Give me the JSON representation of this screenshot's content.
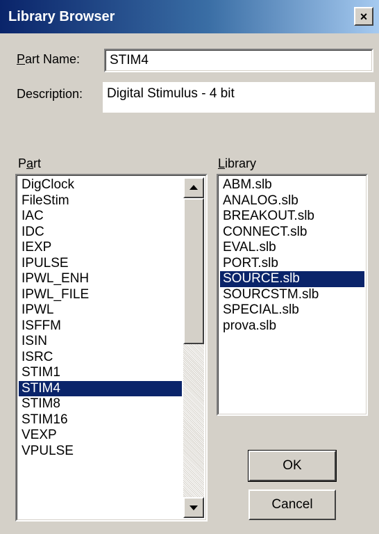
{
  "window": {
    "title": "Library Browser",
    "close_label": "×"
  },
  "part_name": {
    "label_prefix": "P",
    "label_rest": "art Name:",
    "value": "STIM4"
  },
  "description": {
    "label": "Description:",
    "value": "Digital Stimulus - 4 bit"
  },
  "part_list": {
    "label_prefix": "P",
    "label_u": "a",
    "label_rest": "rt",
    "items": [
      "DigClock",
      "FileStim",
      "IAC",
      "IDC",
      "IEXP",
      "IPULSE",
      "IPWL_ENH",
      "IPWL_FILE",
      "IPWL",
      "ISFFM",
      "ISIN",
      "ISRC",
      "STIM1",
      "STIM4",
      "STIM8",
      "STIM16",
      "VEXP",
      "VPULSE"
    ],
    "selected": "STIM4",
    "scroll_position": 0.0
  },
  "library_list": {
    "label_u": "L",
    "label_rest": "ibrary",
    "items": [
      "ABM.slb",
      "ANALOG.slb",
      "BREAKOUT.slb",
      "CONNECT.slb",
      "EVAL.slb",
      "PORT.slb",
      "SOURCE.slb",
      "SOURCSTM.slb",
      "SPECIAL.slb",
      "prova.slb"
    ],
    "selected": "SOURCE.slb"
  },
  "buttons": {
    "ok": "OK",
    "cancel": "Cancel"
  },
  "icons": {
    "scroll_up": "arrow-up-icon",
    "scroll_down": "arrow-down-icon",
    "close": "close-icon"
  },
  "colors": {
    "selection": "#0a246a",
    "dialog_bg": "#d4d0c8",
    "titlebar_start": "#0a246a",
    "titlebar_end": "#a6caf0"
  }
}
